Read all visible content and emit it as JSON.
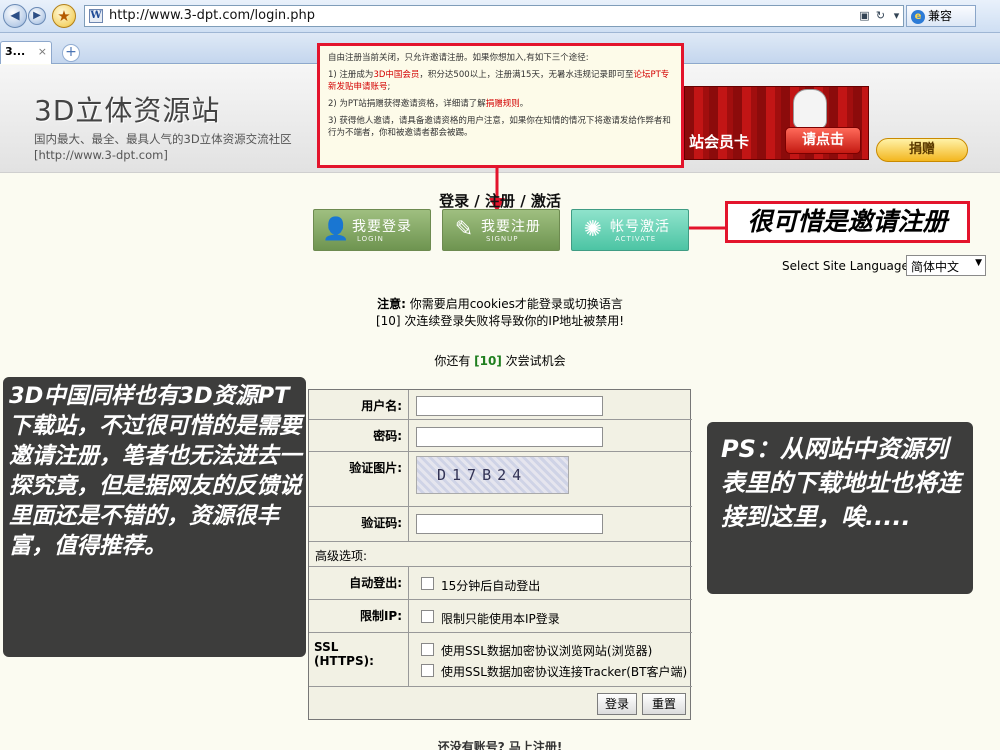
{
  "browser": {
    "url": "http://www.3-dpt.com/login.php",
    "tab_title": "3...",
    "tab_close": "×",
    "new_tab": "+",
    "compat_label": "兼容",
    "compat_icon": "e",
    "page_icon": "W",
    "back_glyph": "◀",
    "forward_glyph": "▶",
    "star_glyph": "★",
    "addr_icons": [
      "compat-view-icon",
      "refresh-icon",
      "dropdown-icon"
    ]
  },
  "site": {
    "logo": "3D立体资源站",
    "slogan_line1": "国内最大、最全、最具人气的3D立体资源交流社区",
    "slogan_line2": "[http://www.3-dpt.com]",
    "banner_text": "站会员卡",
    "banner_button": "请点击",
    "donate_button": "捐赠"
  },
  "notice": {
    "line1": "自由注册当前关闭，只允许邀请注册。如果你想加入,有如下三个途径:",
    "item1_pre": "1) 注册成为",
    "item1_red1": "3D中国会员",
    "item1_mid": "，积分达500以上，注册满15天，无暑水违规记录即可至",
    "item1_red2": "论坛PT专新发贴申请账号",
    "item1_post": ";",
    "item2_pre": "2) 为PT站捐赠获得邀请资格，详细请了解",
    "item2_red": "捐赠规则",
    "item2_post": "。",
    "item3": "3) 获得他人邀请，请具备邀请资格的用户注意，如果你在知情的情况下将邀请发给作弊者和行为不端者，你和被邀请者都会被踢。"
  },
  "login_section": {
    "title": "登录 / 注册 / 激活",
    "login_btn": "我要登录",
    "login_sub": "LOGIN",
    "signup_btn": "我要注册",
    "signup_sub": "SIGNUP",
    "activate_btn": "帐号激活",
    "activate_sub": "ACTIVATE",
    "language_label": "Select Site Language:",
    "language_value": "简体中文",
    "cookie_prefix": "注意:",
    "cookie_text": " 你需要启用cookies才能登录或切换语言",
    "ban_note": "[10] 次连续登录失败将导致你的IP地址被禁用!",
    "attempts_pre": "你还有 ",
    "attempts_count": "[10]",
    "attempts_post": " 次尝试机会"
  },
  "form": {
    "username_label": "用户名:",
    "username_value": "",
    "password_label": "密码:",
    "password_value": "",
    "captcha_label": "验证图片:",
    "captcha_text": "D17B24",
    "code_label": "验证码:",
    "code_value": "",
    "advanced_label": "高级选项:",
    "autologout_label": "自动登出:",
    "autologout_text": "15分钟后自动登出",
    "ip_label": "限制IP:",
    "ip_text": "限制只能使用本IP登录",
    "ssl_label": "SSL (HTTPS):",
    "ssl_option1": "使用SSL数据加密协议浏览网站(浏览器)",
    "ssl_option2": "使用SSL数据加密协议连接Tracker(BT客户端)",
    "submit_label": "登录",
    "reset_label": "重置"
  },
  "annotations": {
    "invite_note": "很可惜是邀请注册",
    "left_caption": "3D中国同样也有3D资源PT下载站，不过很可惜的是需要邀请注册，笔者也无法进去一探究竟，但是据网友的反馈说里面还是不错的，资源很丰富，值得推荐。",
    "right_caption": "PS：从网站中资源列表里的下载地址也将连接到这里，唉....."
  },
  "bottom_text": "还没有账号? 马上注册!",
  "colors": {
    "annotation_red": "#e3142c",
    "button_green": "#7da15c",
    "activate_teal": "#4cc4a4",
    "page_bg": "#fbfbf1"
  }
}
